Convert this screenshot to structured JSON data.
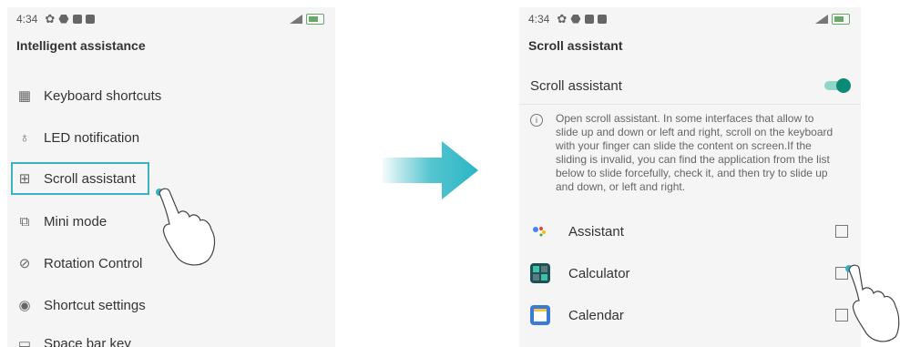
{
  "status_bar": {
    "time": "4:34"
  },
  "left_screen": {
    "title": "Intelligent assistance",
    "items": [
      {
        "label": "Keyboard shortcuts",
        "icon": "keyboard-icon"
      },
      {
        "label": "LED notification",
        "icon": "bulb-icon"
      },
      {
        "label": "Scroll assistant",
        "icon": "scroll-icon"
      },
      {
        "label": "Mini mode",
        "icon": "mini-mode-icon"
      },
      {
        "label": "Rotation Control",
        "icon": "rotation-icon"
      },
      {
        "label": "Shortcut settings",
        "icon": "shortcut-icon"
      },
      {
        "label": "Space bar key",
        "icon": "space-bar-icon"
      }
    ]
  },
  "right_screen": {
    "title": "Scroll assistant",
    "toggle_label": "Scroll assistant",
    "toggle_on": true,
    "description": "Open scroll assistant. In some interfaces that allow to slide up and down or left and right, scroll on the keyboard with your finger can slide the content on screen.If the sliding is invalid, you can find the application from the list below to slide forcefully, check it, and then try to slide up and down, or left and right.",
    "apps": [
      {
        "label": "Assistant",
        "icon": "assistant-icon",
        "checked": false
      },
      {
        "label": "Calculator",
        "icon": "calculator-icon",
        "checked": false
      },
      {
        "label": "Calendar",
        "icon": "calendar-icon",
        "checked": false
      }
    ]
  },
  "colors": {
    "highlight": "#39b2c2",
    "toggle_accent": "#0d8a76",
    "arrow": "#2bb6c4"
  }
}
